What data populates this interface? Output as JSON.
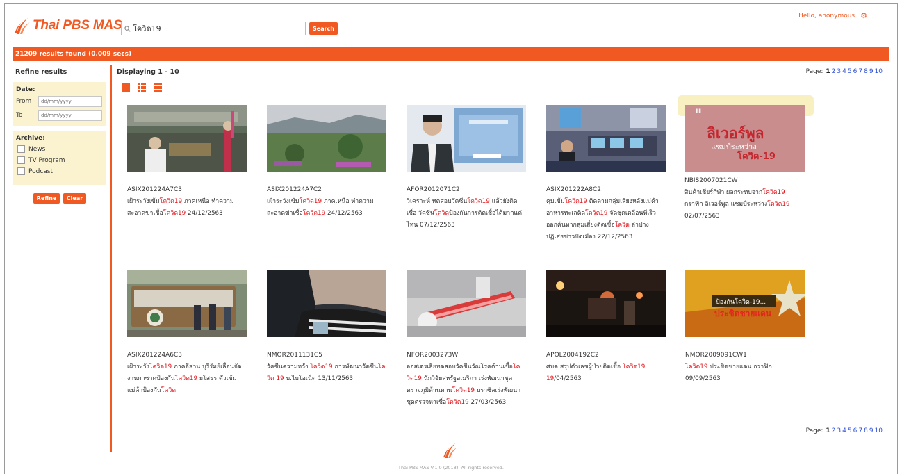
{
  "header": {
    "logo_text": "Thai PBS MAS",
    "search_value": "โควิด19",
    "search_button": "Search",
    "user_greeting": "Hello, anonymous"
  },
  "results_bar": "21209 results found (0.009 secs)",
  "sidebar": {
    "title": "Refine results",
    "date_title": "Date:",
    "from_label": "From",
    "to_label": "To",
    "date_placeholder": "dd/mm/yyyy",
    "archive_title": "Archive:",
    "archive_options": [
      "News",
      "TV Program",
      "Podcast"
    ],
    "refine_button": "Refine",
    "clear_button": "Clear"
  },
  "main": {
    "displaying": "Displaying 1 - 10",
    "page_label": "Page:",
    "pages": [
      "1",
      "2",
      "3",
      "4",
      "5",
      "6",
      "7",
      "8",
      "9",
      "10"
    ],
    "current_page": "1"
  },
  "cards": [
    {
      "code": "ASIX201224A7C3",
      "parts": [
        [
          "เฝ้าระวังเข้ม",
          0
        ],
        [
          "โควิด19",
          1
        ],
        [
          " ภาคเหนือ ทำความสะอาดฆ่าเชื้อ",
          0
        ],
        [
          "โควิด19",
          1
        ],
        [
          " 24/12/2563",
          0
        ]
      ]
    },
    {
      "code": "ASIX201224A7C2",
      "parts": [
        [
          "เฝ้าระวังเข้ม",
          0
        ],
        [
          "โควิด19",
          1
        ],
        [
          " ภาคเหนือ ทำความสะอาดฆ่าเชื้อ",
          0
        ],
        [
          "โควิด19",
          1
        ],
        [
          " 24/12/2563",
          0
        ]
      ]
    },
    {
      "code": "AFOR2012071C2",
      "parts": [
        [
          "วิเคราะห์ ทดสอบวัคซีน",
          0
        ],
        [
          "โควิด19",
          1
        ],
        [
          " แล้วยังติดเชื้อ วัคซีน",
          0
        ],
        [
          "โควิด",
          1
        ],
        [
          "ป้องกันการติดเชื้อได้มากแค่ไหน 07/12/2563",
          0
        ]
      ]
    },
    {
      "code": "ASIX201222A8C2",
      "parts": [
        [
          "คุมเข้ม",
          0
        ],
        [
          "โควิด19",
          1
        ],
        [
          " ติดตามกลุ่มเสี่ยงหลังแม่ค้าอาหารทะเลติด",
          0
        ],
        [
          "โควิด19",
          1
        ],
        [
          " จัดชุดเคลื่อนที่เร็วออกค้นหากลุ่มเสี่ยงติดเชื้อ",
          0
        ],
        [
          "โควิด",
          1
        ],
        [
          " ลำปาง ปฏิเสธข่าวปิดเมือง 22/12/2563",
          0
        ]
      ]
    },
    {
      "code": "NBIS2007021CW",
      "parts": [
        [
          "สินค้าเชียร์กีฬา ผลกระทบจาก",
          0
        ],
        [
          "โควิด19",
          1
        ],
        [
          " กราฟิก ลิเวอร์พูล แชมป์ระหว่าง",
          0
        ],
        [
          "โควิด19",
          1
        ],
        [
          " 02/07/2563",
          0
        ]
      ]
    },
    {
      "code": "ASIX201224A6C3",
      "parts": [
        [
          "เฝ้าระวัง",
          0
        ],
        [
          "โควิด19",
          1
        ],
        [
          " ภาคอีสาน บุรีรัมย์เลื่อนจัดงานกาชาดป้องกัน",
          0
        ],
        [
          "โควิด19",
          1
        ],
        [
          " ยโสธร ตัวเข้มแม่ค้าป้องกัน",
          0
        ],
        [
          "โควิด",
          1
        ]
      ]
    },
    {
      "code": "NMOR2011131C5",
      "parts": [
        [
          "วัคซีนความหวัง ",
          0
        ],
        [
          "โควิด19",
          1
        ],
        [
          " การพัฒนาวัคซีน",
          0
        ],
        [
          "โควิด 19",
          1
        ],
        [
          " บ.ไบโอเน็ต 13/11/2563",
          0
        ]
      ]
    },
    {
      "code": "NFOR2003273W",
      "parts": [
        [
          "ออสเตรเลียทดสอบวัคซีนวัณโรคต้านเชื้อ",
          0
        ],
        [
          "โควิด19",
          1
        ],
        [
          " นักวิจัยสหรัฐอเมริกา เร่งพัฒนาชุดตรวจภูมิต้านทาน",
          0
        ],
        [
          "โควิด19",
          1
        ],
        [
          " บราซิลเร่งพัฒนาชุดตรวจหาเชื้อ",
          0
        ],
        [
          "โควิด19",
          1
        ],
        [
          " 27/03/2563",
          0
        ]
      ]
    },
    {
      "code": "APOL2004192C2",
      "parts": [
        [
          "ศบค.สรุปตัวเลขผู้ป่วยติดเชื้อ ",
          0
        ],
        [
          "โควิด19",
          1
        ],
        [
          " 19",
          1
        ],
        [
          "/04/2563",
          0
        ]
      ]
    },
    {
      "code": "NMOR2009091CW1",
      "parts": [
        [
          "โควิด19",
          1
        ],
        [
          " ประชิดชายแดน กราฟิก 09/09/2563",
          0
        ]
      ]
    }
  ],
  "thumb_texts": {
    "liverpool_big": "ลิเวอร์พูล",
    "liverpool_small": "แชมป์ระหว่าง",
    "liverpool_covid": "โควิด-19",
    "border_top": "ป้องกันโควิด-19...",
    "border_bottom": "ประชิดชายแดน"
  },
  "footer": "Thai PBS MAS V.1.0 (2018). All rights reserved.",
  "colors": {
    "accent": "#f05a22",
    "highlight": "#e0151b",
    "panel": "#fbf3d0",
    "link": "#2d4fd6"
  }
}
